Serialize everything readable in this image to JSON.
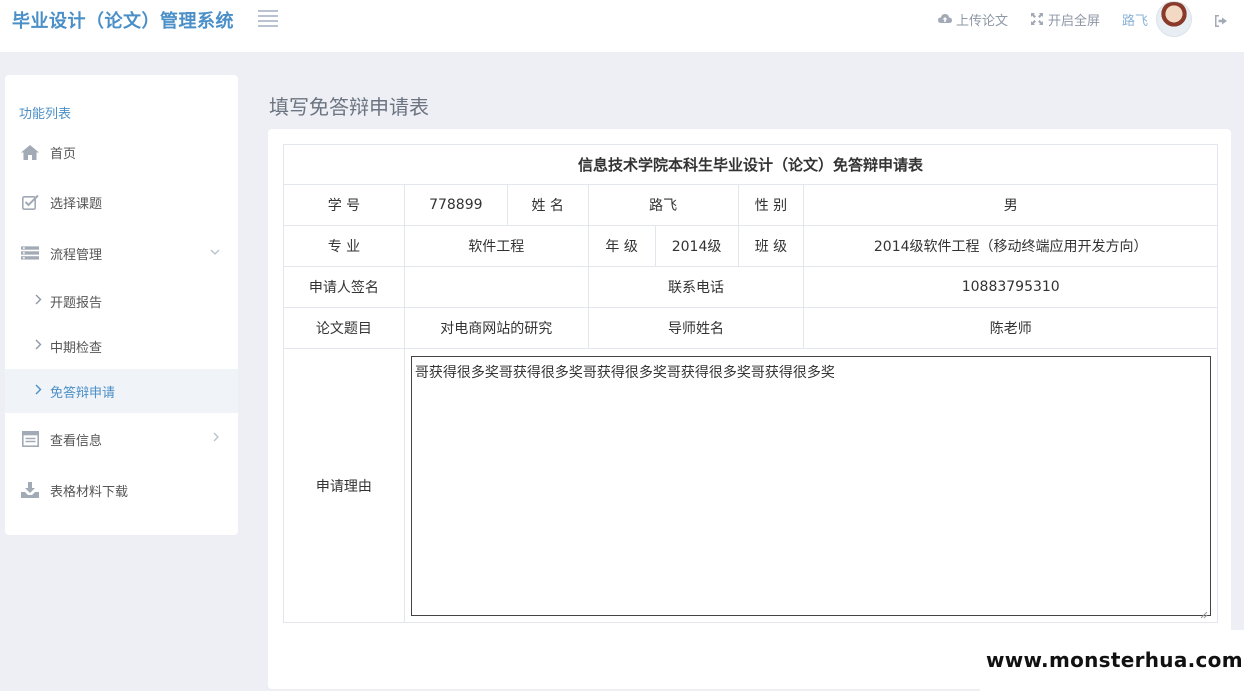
{
  "app": {
    "title": "毕业设计（论文）管理系统"
  },
  "topbar": {
    "upload_label": "上传论文",
    "fullscreen_label": "开启全屏",
    "user_name": "路飞"
  },
  "sidebar": {
    "title": "功能列表",
    "items": [
      {
        "label": "首页",
        "icon": "home-icon"
      },
      {
        "label": "选择课题",
        "icon": "check-square-icon"
      },
      {
        "label": "流程管理",
        "icon": "list-icon",
        "expanded": true
      },
      {
        "label": "查看信息",
        "icon": "table-icon"
      },
      {
        "label": "表格材料下载",
        "icon": "download-icon"
      }
    ],
    "sub_items": [
      {
        "label": "开题报告"
      },
      {
        "label": "中期检查"
      },
      {
        "label": "免答辩申请",
        "active": true
      }
    ]
  },
  "page": {
    "title": "填写免答辩申请表"
  },
  "form": {
    "caption": "信息技术学院本科生毕业设计（论文）免答辩申请表",
    "student_id_label": "学 号",
    "student_id": "778899",
    "name_label": "姓 名",
    "name": "路飞",
    "gender_label": "性 别",
    "gender": "男",
    "major_label": "专 业",
    "major": "软件工程",
    "grade_label": "年 级",
    "grade": "2014级",
    "class_label": "班 级",
    "class": "2014级软件工程（移动终端应用开发方向）",
    "signature_label": "申请人签名",
    "signature": "",
    "phone_label": "联系电话",
    "phone": "10883795310",
    "thesis_title_label": "论文题目",
    "thesis_title": "对电商网站的研究",
    "advisor_label": "导师姓名",
    "advisor": "陈老师",
    "reason_label": "申请理由",
    "reason": "哥获得很多奖哥获得很多奖哥获得很多奖哥获得很多奖哥获得很多奖"
  },
  "watermark": {
    "text": "www.monsterhua.com"
  },
  "colors": {
    "brand": "#4a8fc7",
    "background": "#edeff5",
    "active_bg": "#f0f3f8"
  }
}
